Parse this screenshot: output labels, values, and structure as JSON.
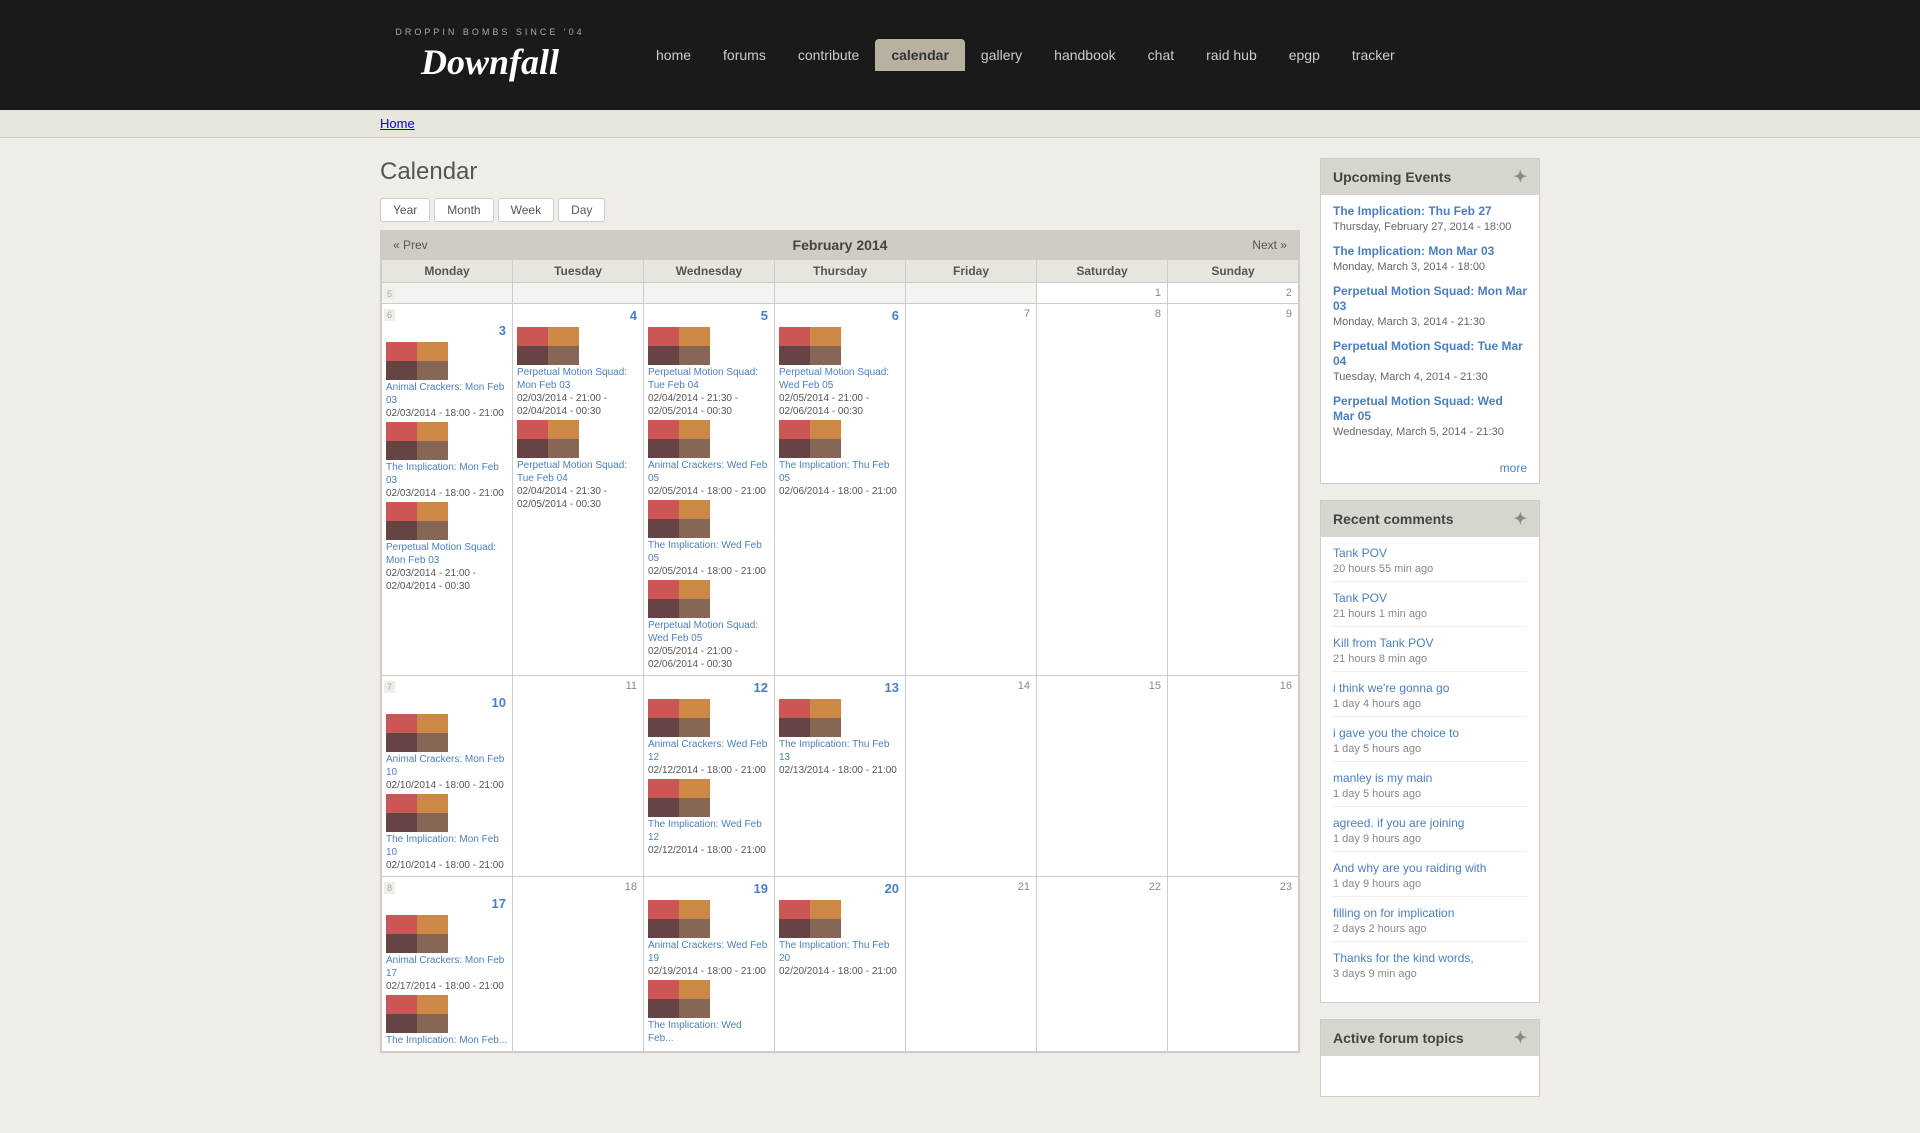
{
  "site": {
    "tagline": "DROPPIN BOMBS SINCE '04",
    "title": "Downfall"
  },
  "nav": {
    "items": [
      {
        "label": "home",
        "id": "home",
        "active": false
      },
      {
        "label": "forums",
        "id": "forums",
        "active": false
      },
      {
        "label": "contribute",
        "id": "contribute",
        "active": false
      },
      {
        "label": "calendar",
        "id": "calendar",
        "active": true
      },
      {
        "label": "gallery",
        "id": "gallery",
        "active": false
      },
      {
        "label": "handbook",
        "id": "handbook",
        "active": false
      },
      {
        "label": "chat",
        "id": "chat",
        "active": false
      },
      {
        "label": "raid hub",
        "id": "raid-hub",
        "active": false
      },
      {
        "label": "epgp",
        "id": "epgp",
        "active": false
      },
      {
        "label": "tracker",
        "id": "tracker",
        "active": false
      }
    ]
  },
  "breadcrumb": {
    "home_label": "Home"
  },
  "calendar": {
    "page_title": "Calendar",
    "controls": {
      "year": "Year",
      "month": "Month",
      "week": "Week",
      "day": "Day"
    },
    "nav": {
      "prev": "« Prev",
      "next": "Next »",
      "month_year": "February 2014"
    },
    "days_of_week": [
      "Monday",
      "Tuesday",
      "Wednesday",
      "Thursday",
      "Friday",
      "Saturday",
      "Sunday"
    ]
  },
  "upcoming_events": {
    "title": "Upcoming Events",
    "events": [
      {
        "title": "The Implication: Thu Feb 27",
        "date": "Thursday, February 27, 2014 - 18:00"
      },
      {
        "title": "The Implication: Mon Mar 03",
        "date": "Monday, March 3, 2014 - 18:00"
      },
      {
        "title": "Perpetual Motion Squad: Mon Mar 03",
        "date": "Monday, March 3, 2014 - 21:30"
      },
      {
        "title": "Perpetual Motion Squad: Tue Mar 04",
        "date": "Tuesday, March 4, 2014 - 21:30"
      },
      {
        "title": "Perpetual Motion Squad: Wed Mar 05",
        "date": "Wednesday, March 5, 2014 - 21:30"
      }
    ],
    "more_label": "more"
  },
  "recent_comments": {
    "title": "Recent comments",
    "comments": [
      {
        "text": "Tank POV",
        "time": "20 hours 55 min ago"
      },
      {
        "text": "Tank POV",
        "time": "21 hours 1 min ago"
      },
      {
        "text": "Kill from Tank POV",
        "time": "21 hours 8 min ago"
      },
      {
        "text": "i think we're gonna go",
        "time": "1 day 4 hours ago"
      },
      {
        "text": "i gave you the choice to",
        "time": "1 day 5 hours ago"
      },
      {
        "text": "manley is my main",
        "time": "1 day 5 hours ago"
      },
      {
        "text": "agreed.  if you are joining",
        "time": "1 day 9 hours ago"
      },
      {
        "text": "And why are you raiding with",
        "time": "1 day 9 hours ago"
      },
      {
        "text": "filling on for implication",
        "time": "2 days 2 hours ago"
      },
      {
        "text": "Thanks for the kind words,",
        "time": "3 days 9 min ago"
      }
    ]
  },
  "active_forum": {
    "title": "Active forum topics"
  }
}
